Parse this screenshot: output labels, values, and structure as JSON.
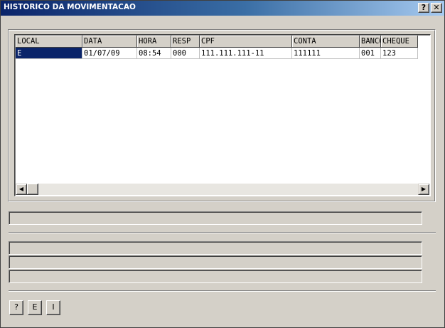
{
  "window": {
    "title": "HISTORICO DA MOVIMENTACAO",
    "help_glyph": "?",
    "close_glyph": "✕"
  },
  "grid": {
    "columns": [
      "LOCAL",
      "DATA",
      "HORA",
      "RESP",
      "CPF",
      "CONTA",
      "BANCO",
      "CHEQUE"
    ],
    "rows": [
      [
        "E",
        "01/07/09",
        "08:54",
        "000",
        "111.111.111-11",
        "111111",
        "001",
        "123"
      ]
    ],
    "selected_row": 0,
    "selected_col": 0,
    "scroll_left_glyph": "◀",
    "scroll_right_glyph": "▶"
  },
  "fields": {
    "status": "",
    "info_1": "",
    "info_2": "",
    "info_3": ""
  },
  "buttons": {
    "help": "?",
    "e": "E",
    "i": "I"
  }
}
